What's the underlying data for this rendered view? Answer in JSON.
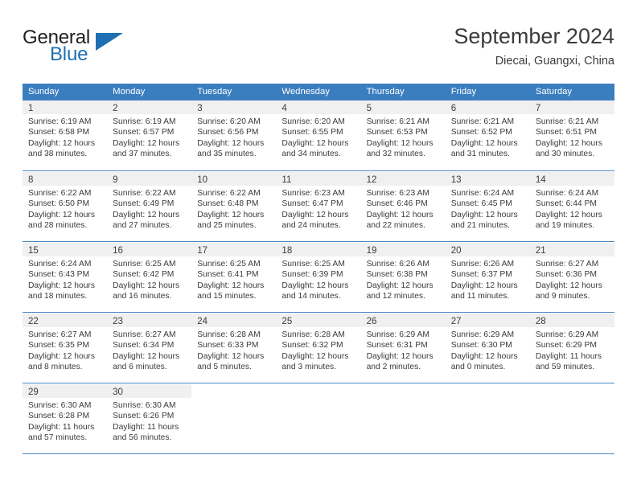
{
  "brand": {
    "name_top": "General",
    "name_bottom": "Blue",
    "triangle_color": "#1f6fb2"
  },
  "header": {
    "title": "September 2024",
    "subtitle": "Diecai, Guangxi, China"
  },
  "theme": {
    "header_blue": "#3b7ebf",
    "row_line_blue": "#4a86c5",
    "daynum_band": "#f0f0f0",
    "text": "#3b3b3b"
  },
  "calendar": {
    "day_headers": [
      "Sunday",
      "Monday",
      "Tuesday",
      "Wednesday",
      "Thursday",
      "Friday",
      "Saturday"
    ],
    "weeks": [
      [
        {
          "day": "1",
          "sunrise": "Sunrise: 6:19 AM",
          "sunset": "Sunset: 6:58 PM",
          "daylight1": "Daylight: 12 hours",
          "daylight2": "and 38 minutes."
        },
        {
          "day": "2",
          "sunrise": "Sunrise: 6:19 AM",
          "sunset": "Sunset: 6:57 PM",
          "daylight1": "Daylight: 12 hours",
          "daylight2": "and 37 minutes."
        },
        {
          "day": "3",
          "sunrise": "Sunrise: 6:20 AM",
          "sunset": "Sunset: 6:56 PM",
          "daylight1": "Daylight: 12 hours",
          "daylight2": "and 35 minutes."
        },
        {
          "day": "4",
          "sunrise": "Sunrise: 6:20 AM",
          "sunset": "Sunset: 6:55 PM",
          "daylight1": "Daylight: 12 hours",
          "daylight2": "and 34 minutes."
        },
        {
          "day": "5",
          "sunrise": "Sunrise: 6:21 AM",
          "sunset": "Sunset: 6:53 PM",
          "daylight1": "Daylight: 12 hours",
          "daylight2": "and 32 minutes."
        },
        {
          "day": "6",
          "sunrise": "Sunrise: 6:21 AM",
          "sunset": "Sunset: 6:52 PM",
          "daylight1": "Daylight: 12 hours",
          "daylight2": "and 31 minutes."
        },
        {
          "day": "7",
          "sunrise": "Sunrise: 6:21 AM",
          "sunset": "Sunset: 6:51 PM",
          "daylight1": "Daylight: 12 hours",
          "daylight2": "and 30 minutes."
        }
      ],
      [
        {
          "day": "8",
          "sunrise": "Sunrise: 6:22 AM",
          "sunset": "Sunset: 6:50 PM",
          "daylight1": "Daylight: 12 hours",
          "daylight2": "and 28 minutes."
        },
        {
          "day": "9",
          "sunrise": "Sunrise: 6:22 AM",
          "sunset": "Sunset: 6:49 PM",
          "daylight1": "Daylight: 12 hours",
          "daylight2": "and 27 minutes."
        },
        {
          "day": "10",
          "sunrise": "Sunrise: 6:22 AM",
          "sunset": "Sunset: 6:48 PM",
          "daylight1": "Daylight: 12 hours",
          "daylight2": "and 25 minutes."
        },
        {
          "day": "11",
          "sunrise": "Sunrise: 6:23 AM",
          "sunset": "Sunset: 6:47 PM",
          "daylight1": "Daylight: 12 hours",
          "daylight2": "and 24 minutes."
        },
        {
          "day": "12",
          "sunrise": "Sunrise: 6:23 AM",
          "sunset": "Sunset: 6:46 PM",
          "daylight1": "Daylight: 12 hours",
          "daylight2": "and 22 minutes."
        },
        {
          "day": "13",
          "sunrise": "Sunrise: 6:24 AM",
          "sunset": "Sunset: 6:45 PM",
          "daylight1": "Daylight: 12 hours",
          "daylight2": "and 21 minutes."
        },
        {
          "day": "14",
          "sunrise": "Sunrise: 6:24 AM",
          "sunset": "Sunset: 6:44 PM",
          "daylight1": "Daylight: 12 hours",
          "daylight2": "and 19 minutes."
        }
      ],
      [
        {
          "day": "15",
          "sunrise": "Sunrise: 6:24 AM",
          "sunset": "Sunset: 6:43 PM",
          "daylight1": "Daylight: 12 hours",
          "daylight2": "and 18 minutes."
        },
        {
          "day": "16",
          "sunrise": "Sunrise: 6:25 AM",
          "sunset": "Sunset: 6:42 PM",
          "daylight1": "Daylight: 12 hours",
          "daylight2": "and 16 minutes."
        },
        {
          "day": "17",
          "sunrise": "Sunrise: 6:25 AM",
          "sunset": "Sunset: 6:41 PM",
          "daylight1": "Daylight: 12 hours",
          "daylight2": "and 15 minutes."
        },
        {
          "day": "18",
          "sunrise": "Sunrise: 6:25 AM",
          "sunset": "Sunset: 6:39 PM",
          "daylight1": "Daylight: 12 hours",
          "daylight2": "and 14 minutes."
        },
        {
          "day": "19",
          "sunrise": "Sunrise: 6:26 AM",
          "sunset": "Sunset: 6:38 PM",
          "daylight1": "Daylight: 12 hours",
          "daylight2": "and 12 minutes."
        },
        {
          "day": "20",
          "sunrise": "Sunrise: 6:26 AM",
          "sunset": "Sunset: 6:37 PM",
          "daylight1": "Daylight: 12 hours",
          "daylight2": "and 11 minutes."
        },
        {
          "day": "21",
          "sunrise": "Sunrise: 6:27 AM",
          "sunset": "Sunset: 6:36 PM",
          "daylight1": "Daylight: 12 hours",
          "daylight2": "and 9 minutes."
        }
      ],
      [
        {
          "day": "22",
          "sunrise": "Sunrise: 6:27 AM",
          "sunset": "Sunset: 6:35 PM",
          "daylight1": "Daylight: 12 hours",
          "daylight2": "and 8 minutes."
        },
        {
          "day": "23",
          "sunrise": "Sunrise: 6:27 AM",
          "sunset": "Sunset: 6:34 PM",
          "daylight1": "Daylight: 12 hours",
          "daylight2": "and 6 minutes."
        },
        {
          "day": "24",
          "sunrise": "Sunrise: 6:28 AM",
          "sunset": "Sunset: 6:33 PM",
          "daylight1": "Daylight: 12 hours",
          "daylight2": "and 5 minutes."
        },
        {
          "day": "25",
          "sunrise": "Sunrise: 6:28 AM",
          "sunset": "Sunset: 6:32 PM",
          "daylight1": "Daylight: 12 hours",
          "daylight2": "and 3 minutes."
        },
        {
          "day": "26",
          "sunrise": "Sunrise: 6:29 AM",
          "sunset": "Sunset: 6:31 PM",
          "daylight1": "Daylight: 12 hours",
          "daylight2": "and 2 minutes."
        },
        {
          "day": "27",
          "sunrise": "Sunrise: 6:29 AM",
          "sunset": "Sunset: 6:30 PM",
          "daylight1": "Daylight: 12 hours",
          "daylight2": "and 0 minutes."
        },
        {
          "day": "28",
          "sunrise": "Sunrise: 6:29 AM",
          "sunset": "Sunset: 6:29 PM",
          "daylight1": "Daylight: 11 hours",
          "daylight2": "and 59 minutes."
        }
      ],
      [
        {
          "day": "29",
          "sunrise": "Sunrise: 6:30 AM",
          "sunset": "Sunset: 6:28 PM",
          "daylight1": "Daylight: 11 hours",
          "daylight2": "and 57 minutes."
        },
        {
          "day": "30",
          "sunrise": "Sunrise: 6:30 AM",
          "sunset": "Sunset: 6:26 PM",
          "daylight1": "Daylight: 11 hours",
          "daylight2": "and 56 minutes."
        },
        {
          "day": "",
          "sunrise": "",
          "sunset": "",
          "daylight1": "",
          "daylight2": ""
        },
        {
          "day": "",
          "sunrise": "",
          "sunset": "",
          "daylight1": "",
          "daylight2": ""
        },
        {
          "day": "",
          "sunrise": "",
          "sunset": "",
          "daylight1": "",
          "daylight2": ""
        },
        {
          "day": "",
          "sunrise": "",
          "sunset": "",
          "daylight1": "",
          "daylight2": ""
        },
        {
          "day": "",
          "sunrise": "",
          "sunset": "",
          "daylight1": "",
          "daylight2": ""
        }
      ]
    ]
  }
}
